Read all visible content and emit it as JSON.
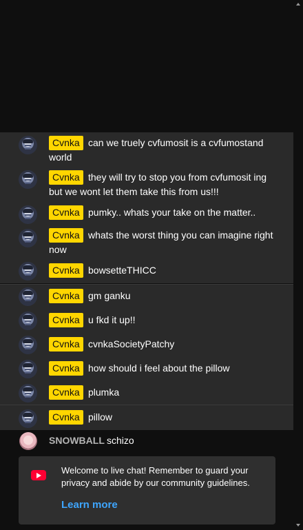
{
  "messages": [
    {
      "author": "Cvnka",
      "text": "can we truely cvfumosit is a cvfumostand world"
    },
    {
      "author": "Cvnka",
      "text": "they will try to stop you from cvfumosit ing but we wont let them take this from us!!!"
    },
    {
      "author": "Cvnka",
      "text": "pumky.. whats your take on the matter.."
    },
    {
      "author": "Cvnka",
      "text": "whats the worst thing you can imagine right now"
    },
    {
      "author": "Cvnka",
      "text": "bowsetteTHICC"
    },
    {
      "author": "Cvnka",
      "text": "gm ganku"
    },
    {
      "author": "Cvnka",
      "text": "u fkd it up!!"
    },
    {
      "author": "Cvnka",
      "text": "cvnkaSocietyPatchy"
    },
    {
      "author": "Cvnka",
      "text": "how should i feel about the pillow"
    },
    {
      "author": "Cvnka",
      "text": "plumka"
    },
    {
      "author": "Cvnka",
      "text": "pillow"
    }
  ],
  "snowball": {
    "author": "SNOWBALL",
    "text": "schizo"
  },
  "welcome": {
    "text": "Welcome to live chat! Remember to guard your privacy and abide by our community guidelines.",
    "link": "Learn more"
  },
  "colors": {
    "badge": "#ffd600",
    "link": "#3ea6ff",
    "panel": "#2a2a2a",
    "youtube": "#ff0033"
  }
}
